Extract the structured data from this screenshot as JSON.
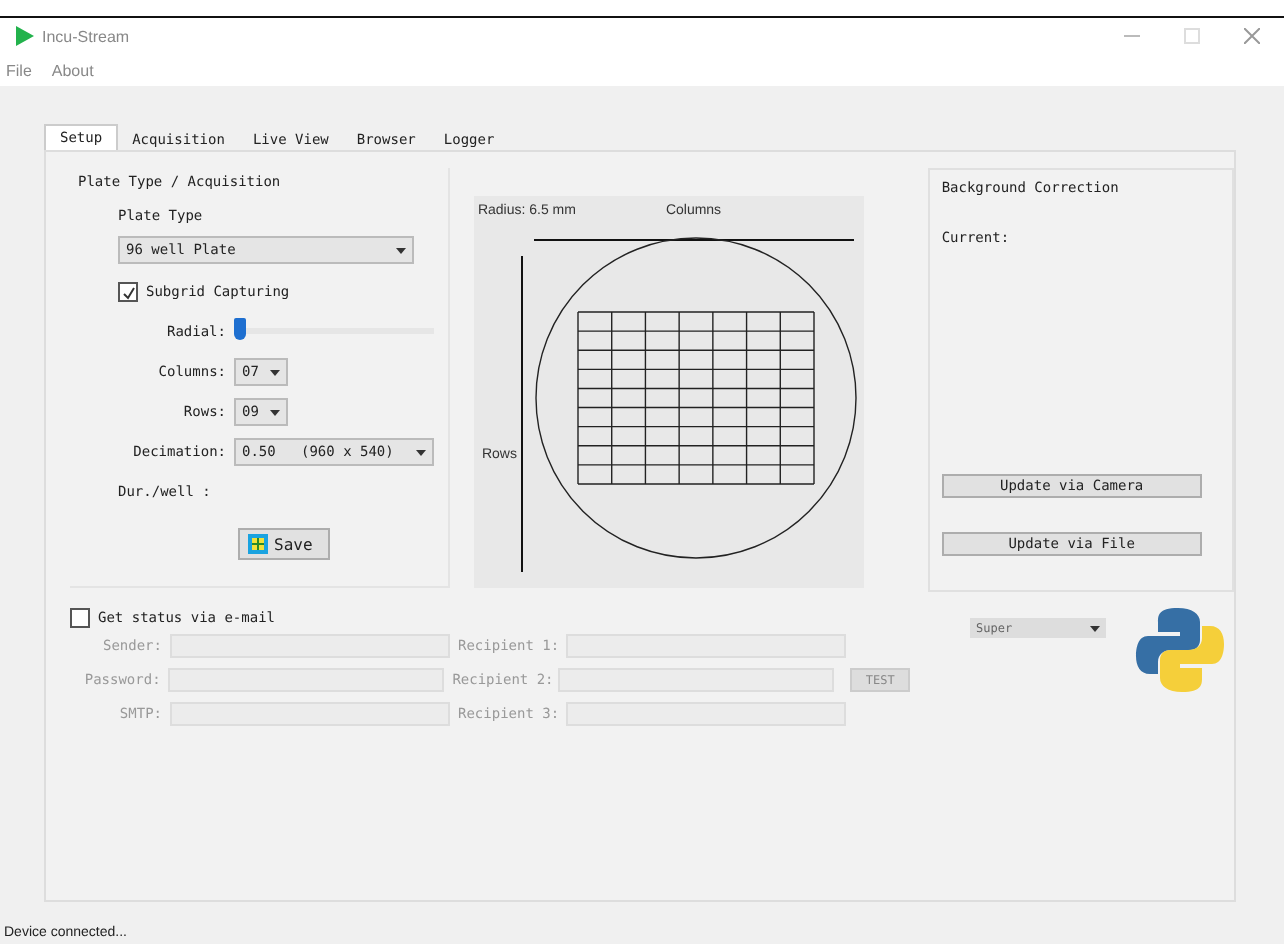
{
  "window": {
    "title": "Incu-Stream"
  },
  "menu": [
    "File",
    "About"
  ],
  "tabs": [
    {
      "label": "Setup",
      "selected": true
    },
    {
      "label": "Acquisition",
      "selected": false
    },
    {
      "label": "Live View",
      "selected": false
    },
    {
      "label": "Browser",
      "selected": false
    },
    {
      "label": "Logger",
      "selected": false
    }
  ],
  "plate_group": {
    "title": "Plate Type / Acquisition",
    "plate_type_label": "Plate Type",
    "plate_type": "96 well Plate",
    "subgrid": {
      "label": "Subgrid Capturing",
      "checked": true
    },
    "radial": {
      "label": "Radial:",
      "level": 0
    },
    "columns": {
      "label": "Columns:",
      "value": "07"
    },
    "rows": {
      "label": "Rows:",
      "value": "09"
    },
    "decimation": {
      "label": "Decimation:",
      "value": "0.50   (960 x 540)"
    },
    "duration": {
      "label": "Dur./well :"
    },
    "save": "Save"
  },
  "diagram": {
    "radius": "Radius: 6.5 mm",
    "columns_label": "Columns",
    "rows_label": "Rows"
  },
  "background": {
    "title": "Background Correction",
    "current": "Current:",
    "buttons": [
      "Update via Camera",
      "Update via File"
    ]
  },
  "email": {
    "label": "Get status via e-mail",
    "checked": false,
    "disabled": true,
    "fields": [
      "Sender:",
      "Password:",
      "SMTP:"
    ],
    "recipients": [
      "Recipient 1:",
      "Recipient 2:",
      "Recipient 3:"
    ],
    "test": "TEST"
  },
  "level_dropdown": "Super",
  "status_bar": "Device connected..."
}
